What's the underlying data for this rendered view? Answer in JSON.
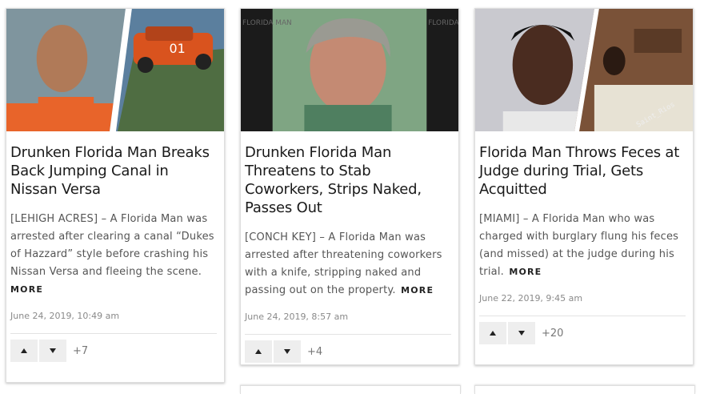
{
  "colors": {
    "accent": "#222222",
    "meta": "#8a8a8a",
    "vote_bg": "#eeeeee"
  },
  "articles": [
    {
      "title": "Drunken Florida Man Breaks Back Jumping Canal in Nissan Versa",
      "excerpt": "[LEHIGH ACRES] – A Florida Man was arrested after clearing a canal “Dukes of Hazzard” style before crashing his Nissan Versa and fleeing the scene.",
      "more": "MORE",
      "date": "June 24, 2019, 10:49 am",
      "score": "+7",
      "image_text": "01"
    },
    {
      "title": "Drunken Florida Man Threatens to Stab Coworkers, Strips Naked, Passes Out",
      "excerpt": "[CONCH KEY] – A Florida Man was arrested after threatening coworkers with a knife, stripping naked and passing out on the property.",
      "more": "MORE",
      "date": "June 24, 2019, 8:57 am",
      "score": "+4",
      "image_text": "FLORIDA MAN"
    },
    {
      "title": "Florida Man Throws Feces at Judge during Trial, Gets Acquitted",
      "excerpt": "[MIAMI] – A Florida Man who was charged with burglary flung his feces (and missed) at the judge during his trial.",
      "more": "MORE",
      "date": "June 22, 2019, 9:45 am",
      "score": "+20",
      "image_text": "Saint_Rios"
    }
  ]
}
